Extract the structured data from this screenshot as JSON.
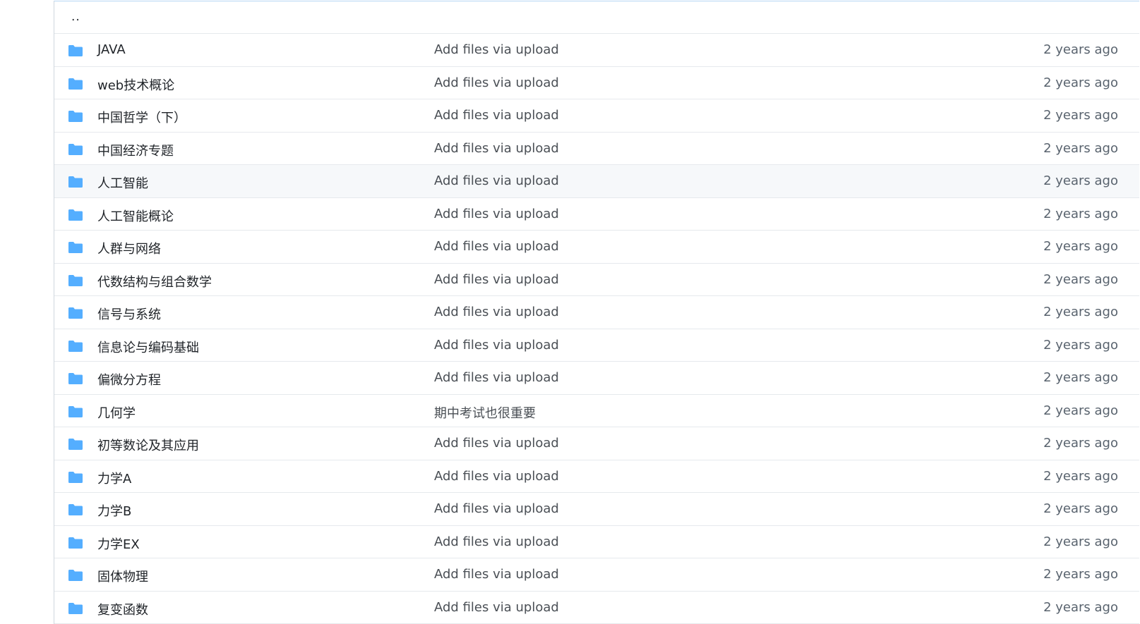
{
  "colors": {
    "folder": "#54aeff",
    "border": "#d0d7de",
    "hover_row": "#f6f8fa"
  },
  "file_list": {
    "parent_dir": "..",
    "rows": [
      {
        "name": "JAVA",
        "message": "Add files via upload",
        "time": "2 years ago",
        "icon": "folder-icon"
      },
      {
        "name": "web技术概论",
        "message": "Add files via upload",
        "time": "2 years ago",
        "icon": "folder-icon"
      },
      {
        "name": "中国哲学（下）",
        "message": "Add files via upload",
        "time": "2 years ago",
        "icon": "folder-icon"
      },
      {
        "name": "中国经济专题",
        "message": "Add files via upload",
        "time": "2 years ago",
        "icon": "folder-icon"
      },
      {
        "name": "人工智能",
        "message": "Add files via upload",
        "time": "2 years ago",
        "icon": "folder-icon",
        "hover": true
      },
      {
        "name": "人工智能概论",
        "message": "Add files via upload",
        "time": "2 years ago",
        "icon": "folder-icon"
      },
      {
        "name": "人群与网络",
        "message": "Add files via upload",
        "time": "2 years ago",
        "icon": "folder-icon"
      },
      {
        "name": "代数结构与组合数学",
        "message": "Add files via upload",
        "time": "2 years ago",
        "icon": "folder-icon"
      },
      {
        "name": "信号与系统",
        "message": "Add files via upload",
        "time": "2 years ago",
        "icon": "folder-icon"
      },
      {
        "name": "信息论与编码基础",
        "message": "Add files via upload",
        "time": "2 years ago",
        "icon": "folder-icon"
      },
      {
        "name": "偏微分方程",
        "message": "Add files via upload",
        "time": "2 years ago",
        "icon": "folder-icon"
      },
      {
        "name": "几何学",
        "message": "期中考试也很重要",
        "time": "2 years ago",
        "icon": "folder-icon"
      },
      {
        "name": "初等数论及其应用",
        "message": "Add files via upload",
        "time": "2 years ago",
        "icon": "folder-icon"
      },
      {
        "name": "力学A",
        "message": "Add files via upload",
        "time": "2 years ago",
        "icon": "folder-icon"
      },
      {
        "name": "力学B",
        "message": "Add files via upload",
        "time": "2 years ago",
        "icon": "folder-icon"
      },
      {
        "name": "力学EX",
        "message": "Add files via upload",
        "time": "2 years ago",
        "icon": "folder-icon"
      },
      {
        "name": "固体物理",
        "message": "Add files via upload",
        "time": "2 years ago",
        "icon": "folder-icon"
      },
      {
        "name": "复变函数",
        "message": "Add files via upload",
        "time": "2 years ago",
        "icon": "folder-icon"
      }
    ]
  }
}
